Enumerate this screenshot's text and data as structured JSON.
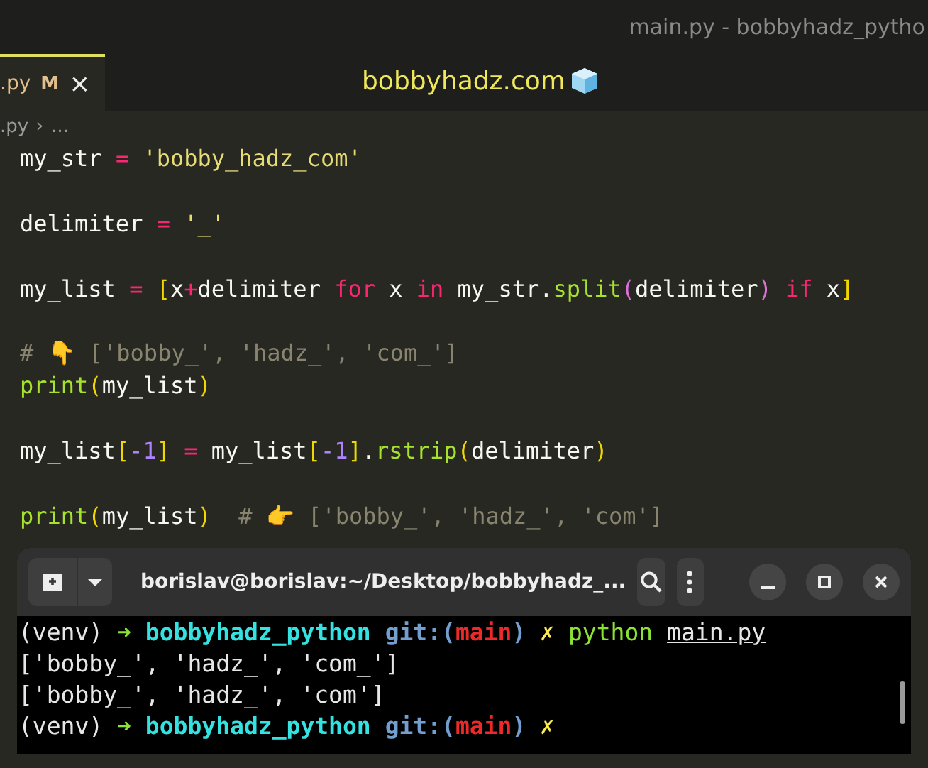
{
  "window": {
    "title": "main.py - bobbyhadz_pytho"
  },
  "tab": {
    "label": ".py",
    "badge": "M",
    "close": "×",
    "selected": true
  },
  "overlay": {
    "text": "bobbyhadz.com"
  },
  "breadcrumb": {
    "file": ".py",
    "separator": "›",
    "more": "…"
  },
  "code_blocks": [
    [
      [
        {
          "t": "my_str ",
          "kind": "plain"
        },
        {
          "t": "=",
          "kind": "op"
        },
        {
          "t": " 'bobby_hadz_com'",
          "kind": "str"
        }
      ]
    ],
    [
      [
        {
          "t": "delimiter ",
          "kind": "plain"
        },
        {
          "t": "=",
          "kind": "op"
        },
        {
          "t": " '_'",
          "kind": "str"
        }
      ]
    ],
    [
      [
        {
          "t": "my_list ",
          "kind": "plain"
        },
        {
          "t": "=",
          "kind": "op"
        },
        {
          "t": " [",
          "kind": "bracket"
        },
        {
          "t": "x",
          "kind": "plain"
        },
        {
          "t": "+",
          "kind": "op"
        },
        {
          "t": "delimiter ",
          "kind": "plain"
        },
        {
          "t": "for",
          "kind": "kw"
        },
        {
          "t": " x ",
          "kind": "plain"
        },
        {
          "t": "in",
          "kind": "kw"
        },
        {
          "t": " my_str.",
          "kind": "plain"
        },
        {
          "t": "split",
          "kind": "fn"
        },
        {
          "t": "(",
          "kind": "bracket2"
        },
        {
          "t": "delimiter",
          "kind": "plain"
        },
        {
          "t": ")",
          "kind": "bracket2"
        },
        {
          "t": " if",
          "kind": "kw"
        },
        {
          "t": " x",
          "kind": "plain"
        },
        {
          "t": "]",
          "kind": "bracket"
        }
      ]
    ],
    [
      [
        {
          "t": "# 👇 ['bobby_', 'hadz_', 'com_']",
          "kind": "comment"
        }
      ],
      [
        {
          "t": "print",
          "kind": "fn"
        },
        {
          "t": "(",
          "kind": "bracket"
        },
        {
          "t": "my_list",
          "kind": "plain"
        },
        {
          "t": ")",
          "kind": "bracket"
        }
      ]
    ],
    [
      [
        {
          "t": "my_list",
          "kind": "plain"
        },
        {
          "t": "[",
          "kind": "bracket"
        },
        {
          "t": "-1",
          "kind": "num"
        },
        {
          "t": "]",
          "kind": "bracket"
        },
        {
          "t": " =",
          "kind": "op"
        },
        {
          "t": " my_list",
          "kind": "plain"
        },
        {
          "t": "[",
          "kind": "bracket"
        },
        {
          "t": "-1",
          "kind": "num"
        },
        {
          "t": "]",
          "kind": "bracket"
        },
        {
          "t": ".",
          "kind": "plain"
        },
        {
          "t": "rstrip",
          "kind": "fn"
        },
        {
          "t": "(",
          "kind": "bracket"
        },
        {
          "t": "delimiter",
          "kind": "plain"
        },
        {
          "t": ")",
          "kind": "bracket"
        }
      ]
    ],
    [
      [
        {
          "t": "print",
          "kind": "fn"
        },
        {
          "t": "(",
          "kind": "bracket"
        },
        {
          "t": "my_list",
          "kind": "plain"
        },
        {
          "t": ")",
          "kind": "bracket"
        },
        {
          "t": "  # 👉 ['bobby_', 'hadz_', 'com']",
          "kind": "comment"
        }
      ]
    ]
  ],
  "terminal": {
    "title": "borislav@borislav:~/Desktop/bobbyhadz_...",
    "lines": [
      [
        {
          "t": "(venv) ",
          "kind": "plain"
        },
        {
          "t": "➜ ",
          "kind": "arrow"
        },
        {
          "t": "bobbyhadz_python ",
          "kind": "dir"
        },
        {
          "t": "git:(",
          "kind": "git"
        },
        {
          "t": "main",
          "kind": "branch"
        },
        {
          "t": ") ",
          "kind": "git"
        },
        {
          "t": "✗ ",
          "kind": "dirty"
        },
        {
          "t": "python ",
          "kind": "cmd"
        },
        {
          "t": "main.py",
          "kind": "path"
        }
      ],
      [
        {
          "t": "['bobby_', 'hadz_', 'com_']",
          "kind": "plain"
        }
      ],
      [
        {
          "t": "['bobby_', 'hadz_', 'com']",
          "kind": "plain"
        }
      ],
      [
        {
          "t": "(venv) ",
          "kind": "plain"
        },
        {
          "t": "➜ ",
          "kind": "arrow"
        },
        {
          "t": "bobbyhadz_python ",
          "kind": "dir"
        },
        {
          "t": "git:(",
          "kind": "git"
        },
        {
          "t": "main",
          "kind": "branch"
        },
        {
          "t": ") ",
          "kind": "git"
        },
        {
          "t": "✗",
          "kind": "dirty"
        }
      ]
    ]
  }
}
